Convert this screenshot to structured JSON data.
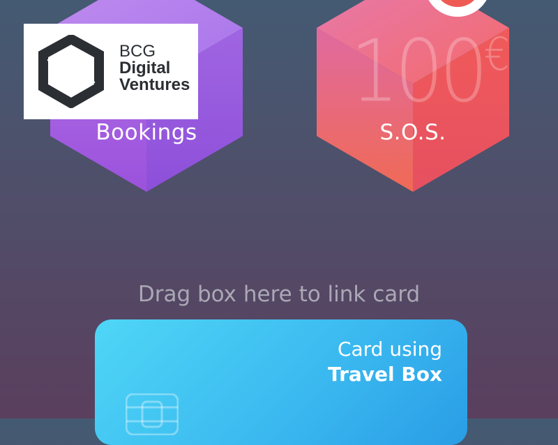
{
  "logo": {
    "line1": "BCG",
    "line2": "Digital",
    "line3": "Ventures"
  },
  "boxes": [
    {
      "label": "Bookings",
      "color": "#9b5fe0"
    },
    {
      "label": "S.O.S.",
      "amount": "100",
      "currency": "€",
      "color": "#f0605a"
    }
  ],
  "drag_hint": "Drag box here to link card",
  "card": {
    "line1": "Card using",
    "line2": "Travel Box",
    "color": "#3bbaf0"
  },
  "icons": [
    "logo-hexagon-icon",
    "sos-badge-icon",
    "card-chip-icon"
  ]
}
